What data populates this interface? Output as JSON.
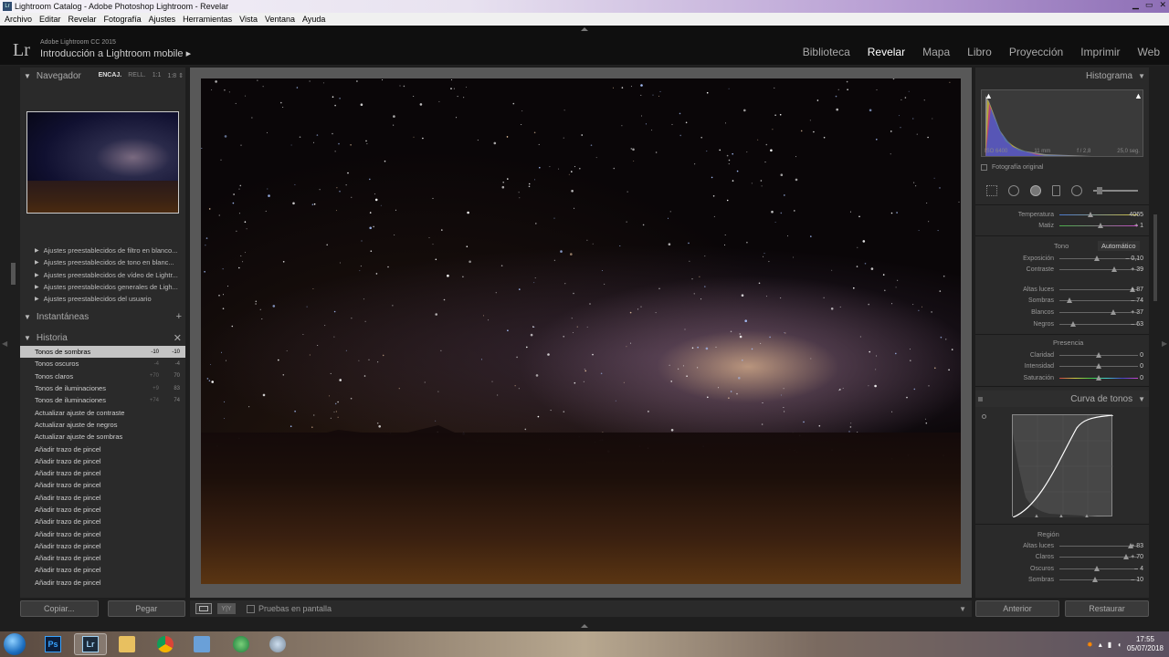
{
  "window": {
    "title": "Lightroom Catalog - Adobe Photoshop Lightroom - Revelar"
  },
  "menu": [
    "Archivo",
    "Editar",
    "Revelar",
    "Fotografía",
    "Ajustes",
    "Herramientas",
    "Vista",
    "Ventana",
    "Ayuda"
  ],
  "identity": {
    "logo": "Lr",
    "product": "Adobe Lightroom CC 2015",
    "plate": "Introducción a Lightroom mobile ▸"
  },
  "modules": [
    "Biblioteca",
    "Revelar",
    "Mapa",
    "Libro",
    "Proyección",
    "Imprimir",
    "Web"
  ],
  "active_module": "Revelar",
  "left": {
    "navigator": {
      "title": "Navegador",
      "zoom": [
        "ENCAJ.",
        "RELL.",
        "1:1",
        "1:8 ⇕"
      ]
    },
    "presets": [
      "Ajustes preestablecidos de filtro en blanco...",
      "Ajustes preestablecidos de tono en blanc...",
      "Ajustes preestablecidos de vídeo de Lightr...",
      "Ajustes preestablecidos generales de Ligh...",
      "Ajustes preestablecidos del usuario"
    ],
    "snapshots_title": "Instantáneas",
    "history_title": "Historia",
    "history": [
      {
        "label": "Tonos de sombras",
        "v1": "-10",
        "v2": "-10"
      },
      {
        "label": "Tonos oscuros",
        "v1": "-4",
        "v2": "-4"
      },
      {
        "label": "Tonos claros",
        "v1": "+70",
        "v2": "70"
      },
      {
        "label": "Tonos de iluminaciones",
        "v1": "+9",
        "v2": "83"
      },
      {
        "label": "Tonos de iluminaciones",
        "v1": "+74",
        "v2": "74"
      },
      {
        "label": "Actualizar ajuste de contraste",
        "v1": "",
        "v2": ""
      },
      {
        "label": "Actualizar ajuste de negros",
        "v1": "",
        "v2": ""
      },
      {
        "label": "Actualizar ajuste de sombras",
        "v1": "",
        "v2": ""
      },
      {
        "label": "Añadir trazo de pincel",
        "v1": "",
        "v2": ""
      },
      {
        "label": "Añadir trazo de pincel",
        "v1": "",
        "v2": ""
      },
      {
        "label": "Añadir trazo de pincel",
        "v1": "",
        "v2": ""
      },
      {
        "label": "Añadir trazo de pincel",
        "v1": "",
        "v2": ""
      },
      {
        "label": "Añadir trazo de pincel",
        "v1": "",
        "v2": ""
      },
      {
        "label": "Añadir trazo de pincel",
        "v1": "",
        "v2": ""
      },
      {
        "label": "Añadir trazo de pincel",
        "v1": "",
        "v2": ""
      },
      {
        "label": "Añadir trazo de pincel",
        "v1": "",
        "v2": ""
      },
      {
        "label": "Añadir trazo de pincel",
        "v1": "",
        "v2": ""
      },
      {
        "label": "Añadir trazo de pincel",
        "v1": "",
        "v2": ""
      },
      {
        "label": "Añadir trazo de pincel",
        "v1": "",
        "v2": ""
      },
      {
        "label": "Añadir trazo de pincel",
        "v1": "",
        "v2": ""
      }
    ],
    "copy_button": "Copiar...",
    "paste_button": "Pegar"
  },
  "toolbar": {
    "view_toggle": "Y|Y",
    "softproof": "Pruebas en pantalla"
  },
  "right": {
    "histogram_title": "Histograma",
    "histogram_info": [
      "ISO 6400",
      "11 mm",
      "f / 2,8",
      "25,0 seg."
    ],
    "original_photo": "Fotografía original",
    "basic": [
      {
        "label": "Temperatura",
        "val": "4065",
        "pos": 0.4
      },
      {
        "label": "Matiz",
        "val": "+ 1",
        "pos": 0.52
      }
    ],
    "tone_label": "Tono",
    "auto_label": "Automático",
    "tone": [
      {
        "label": "Exposición",
        "val": "– 0,10",
        "pos": 0.48
      },
      {
        "label": "Contraste",
        "val": "+ 39",
        "pos": 0.7
      }
    ],
    "tone2": [
      {
        "label": "Altas luces",
        "val": "+ 87",
        "pos": 0.93
      },
      {
        "label": "Sombras",
        "val": "– 74",
        "pos": 0.13
      },
      {
        "label": "Blancos",
        "val": "+ 37",
        "pos": 0.69
      },
      {
        "label": "Negros",
        "val": "– 63",
        "pos": 0.18
      }
    ],
    "presence_label": "Presencia",
    "presence": [
      {
        "label": "Claridad",
        "val": "0",
        "pos": 0.5
      },
      {
        "label": "Intensidad",
        "val": "0",
        "pos": 0.5
      },
      {
        "label": "Saturación",
        "val": "0",
        "pos": 0.5
      }
    ],
    "curve_title": "Curva de tonos",
    "region_label": "Región",
    "region": [
      {
        "label": "Altas luces",
        "val": "+ 83",
        "pos": 0.91
      },
      {
        "label": "Claros",
        "val": "+ 70",
        "pos": 0.85
      },
      {
        "label": "Oscuros",
        "val": "– 4",
        "pos": 0.48
      },
      {
        "label": "Sombras",
        "val": "– 10",
        "pos": 0.45
      }
    ],
    "prev_button": "Anterior",
    "reset_button": "Restaurar"
  },
  "taskbar": {
    "time": "17:55",
    "date": "05/07/2018",
    "apps": [
      "Ps",
      "Lr",
      "",
      "",
      "",
      "",
      ""
    ]
  }
}
